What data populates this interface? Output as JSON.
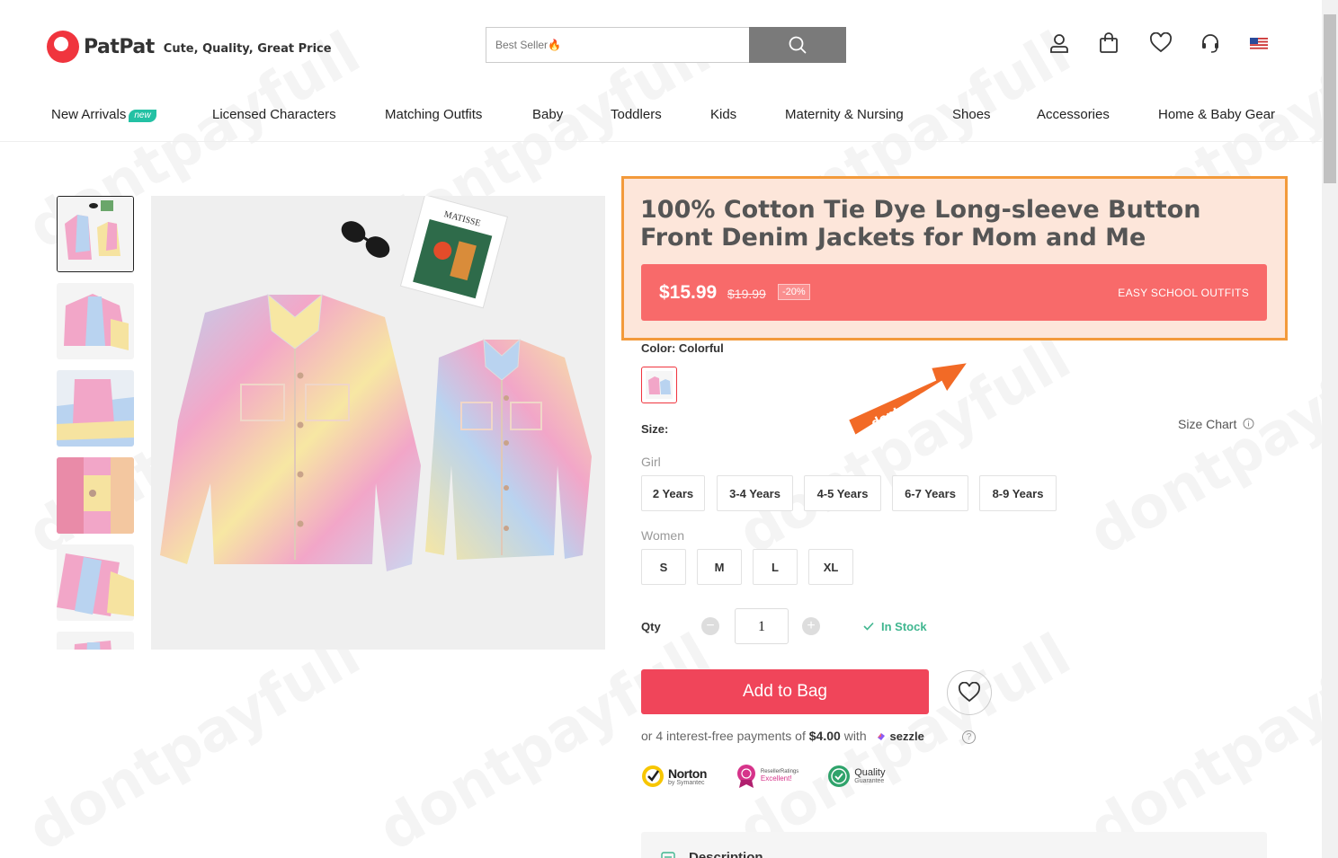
{
  "header": {
    "brand": "PatPat",
    "tagline": "Cute, Quality, Great Price",
    "search_placeholder": "Best Seller🔥"
  },
  "nav": [
    "New Arrivals",
    "Licensed Characters",
    "Matching Outfits",
    "Baby",
    "Toddlers",
    "Kids",
    "Maternity & Nursing",
    "Shoes",
    "Accessories",
    "Home & Baby Gear"
  ],
  "nav_badge": "new",
  "product": {
    "title": "100% Cotton Tie Dye Long-sleeve Button Front Denim Jackets for Mom and Me",
    "price": "$15.99",
    "original_price": "$19.99",
    "discount": "-20%",
    "promo": "EASY SCHOOL OUTFITS",
    "color_label": "Color: Colorful",
    "size_label": "Size:",
    "size_chart": "Size Chart",
    "girl_label": "Girl",
    "girl_sizes": [
      "2 Years",
      "3-4 Years",
      "4-5 Years",
      "6-7 Years",
      "8-9 Years"
    ],
    "women_label": "Women",
    "women_sizes": [
      "S",
      "M",
      "L",
      "XL"
    ],
    "qty_label": "Qty",
    "qty": "1",
    "stock": "In Stock",
    "add_to_bag": "Add to Bag",
    "pay_prefix": "or 4 interest-free payments of",
    "pay_amount": "$4.00",
    "pay_with": "with",
    "pay_provider": "sezzle",
    "description_label": "Description"
  },
  "badges": {
    "norton": "Norton",
    "norton_sub": "by Symantec",
    "reseller": "ResellerRatings",
    "reseller_sub": "Excellent!",
    "quality": "Quality",
    "quality_sub": "Guarantee"
  },
  "watermark": "dontpayfull",
  "colors": {
    "accent": "#f0455a",
    "price_bar": "#f86a6a",
    "highlight_border": "#f39a3b",
    "highlight_fill": "#fde6da",
    "stock": "#3fb68f"
  }
}
